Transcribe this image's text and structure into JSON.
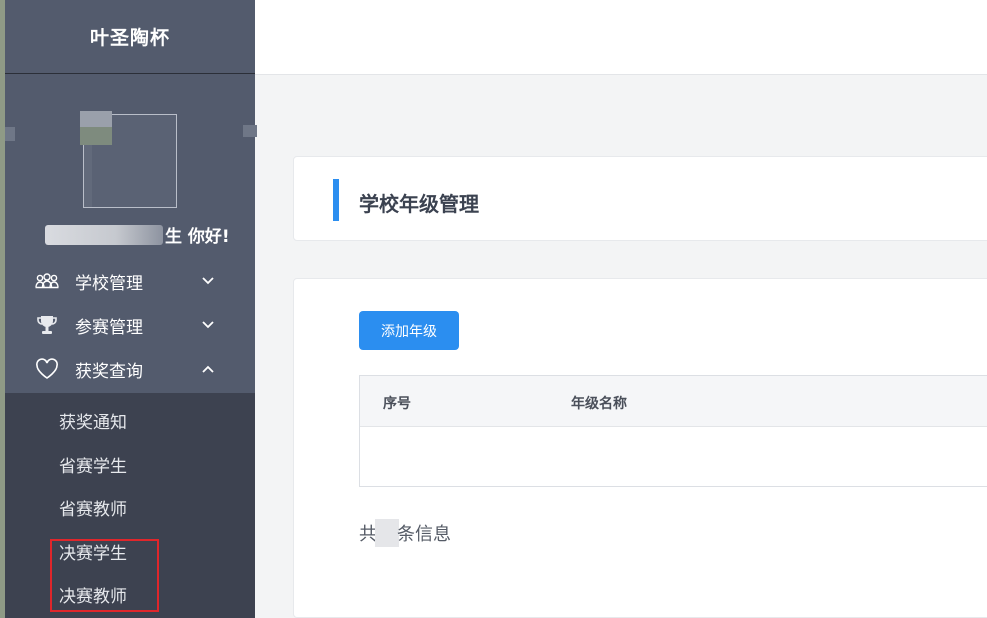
{
  "app": {
    "brand": "叶圣陶杯"
  },
  "user": {
    "greeting_suffix": "生 你好!"
  },
  "sidebar": {
    "menu": [
      {
        "label": "学校管理",
        "icon": "users-icon",
        "expanded": false
      },
      {
        "label": "参赛管理",
        "icon": "trophy-icon",
        "expanded": false
      },
      {
        "label": "获奖查询",
        "icon": "heart-icon",
        "expanded": true
      }
    ],
    "submenu": [
      {
        "label": "获奖通知"
      },
      {
        "label": "省赛学生"
      },
      {
        "label": "省赛教师"
      },
      {
        "label": "决赛学生"
      },
      {
        "label": "决赛教师"
      }
    ]
  },
  "page": {
    "title": "学校年级管理",
    "add_button": "添加年级",
    "table": {
      "columns": [
        "序号",
        "年级名称"
      ],
      "rows": []
    },
    "footer": {
      "prefix": "共",
      "suffix": "条信息"
    }
  },
  "colors": {
    "sidebar": "#535b6d",
    "submenu": "#3d4250",
    "accent": "#2b8ef0",
    "highlight": "#e0262b"
  }
}
